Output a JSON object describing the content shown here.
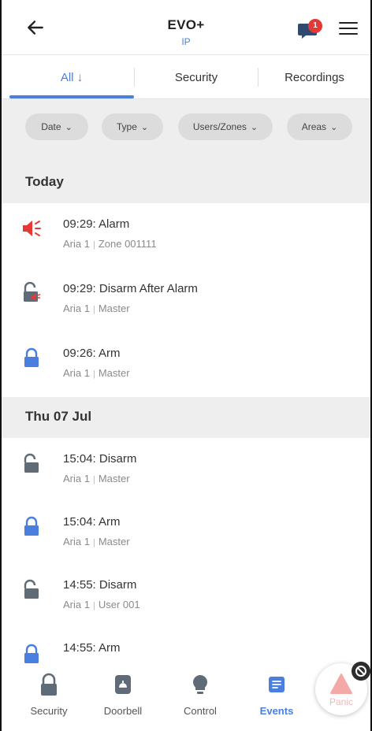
{
  "header": {
    "title": "EVO+",
    "subtitle": "IP",
    "notification_count": "1",
    "icons": [
      "back-arrow-icon",
      "notification-icon",
      "hamburger-menu-icon"
    ]
  },
  "tabs": [
    {
      "label": "All ↓",
      "active": true
    },
    {
      "label": "Security",
      "active": false
    },
    {
      "label": "Recordings",
      "active": false
    }
  ],
  "filters": [
    {
      "label": "Date"
    },
    {
      "label": "Type"
    },
    {
      "label": "Users/Zones"
    },
    {
      "label": "Areas"
    }
  ],
  "sections": [
    {
      "title": "Today",
      "events": [
        {
          "title": "09:29: Alarm",
          "area": "Aria 1",
          "detail": "Zone 001111",
          "icon": "alarm-siren-icon"
        },
        {
          "title": "09:29: Disarm After Alarm",
          "area": "Aria 1",
          "detail": "Master",
          "icon": "disarm-after-alarm-icon"
        },
        {
          "title": "09:26: Arm",
          "area": "Aria 1",
          "detail": "Master",
          "icon": "lock-closed-icon"
        }
      ]
    },
    {
      "title": "Thu 07 Jul",
      "events": [
        {
          "title": "15:04: Disarm",
          "area": "Aria 1",
          "detail": "Master",
          "icon": "lock-open-icon"
        },
        {
          "title": "15:04: Arm",
          "area": "Aria 1",
          "detail": "Master",
          "icon": "lock-closed-icon"
        },
        {
          "title": "14:55: Disarm",
          "area": "Aria 1",
          "detail": "User 001",
          "icon": "lock-open-icon"
        },
        {
          "title": "14:55: Arm",
          "icon": "lock-closed-icon"
        }
      ]
    }
  ],
  "bottom_nav": [
    {
      "label": "Security",
      "icon": "lock-icon",
      "active": false
    },
    {
      "label": "Doorbell",
      "icon": "doorbell-icon",
      "active": false
    },
    {
      "label": "Control",
      "icon": "bulb-icon",
      "active": false
    },
    {
      "label": "Events",
      "icon": "events-list-icon",
      "active": true
    }
  ],
  "panic": {
    "label": "Panic"
  },
  "colors": {
    "accent": "#4a7fe0",
    "alarm": "#e53935",
    "lock_closed": "#4a7fe0",
    "lock_open": "#5f6b76"
  }
}
